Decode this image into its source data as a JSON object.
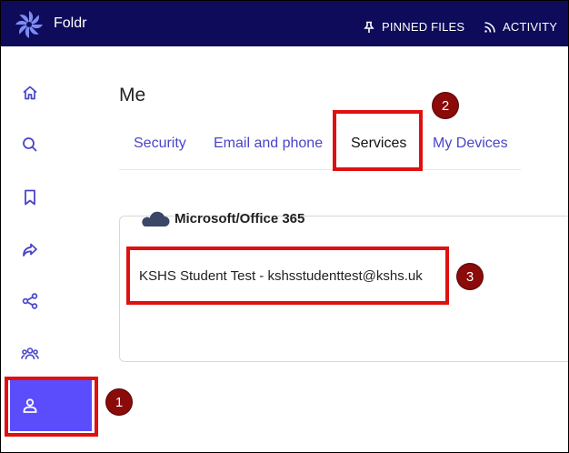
{
  "app": {
    "title": "Foldr"
  },
  "header": {
    "pinned_files_label": "PINNED FILES",
    "activity_label": "ACTIVITY"
  },
  "sidebar": {
    "items": [
      {
        "icon": "home-icon"
      },
      {
        "icon": "search-icon"
      },
      {
        "icon": "bookmark-icon"
      },
      {
        "icon": "share-arrow-icon"
      },
      {
        "icon": "share-nodes-icon"
      },
      {
        "icon": "group-icon"
      },
      {
        "icon": "user-icon",
        "active": true
      }
    ]
  },
  "page": {
    "title": "Me"
  },
  "tabs": [
    {
      "label": "Security"
    },
    {
      "label": "Email and phone"
    },
    {
      "label": "Services",
      "active": true
    },
    {
      "label": "My Devices"
    }
  ],
  "service": {
    "icon": "cloud-icon",
    "name": "Microsoft/Office 365",
    "account": "KSHS Student Test - kshsstudenttest@kshs.uk"
  },
  "annotations": {
    "step1": "1",
    "step2": "2",
    "step3": "3"
  },
  "colors": {
    "topbar": "#0e0b5a",
    "accent": "#5b4dfc",
    "link": "#4a45c7",
    "highlight": "#e01010",
    "badge": "#8b0a0a"
  }
}
